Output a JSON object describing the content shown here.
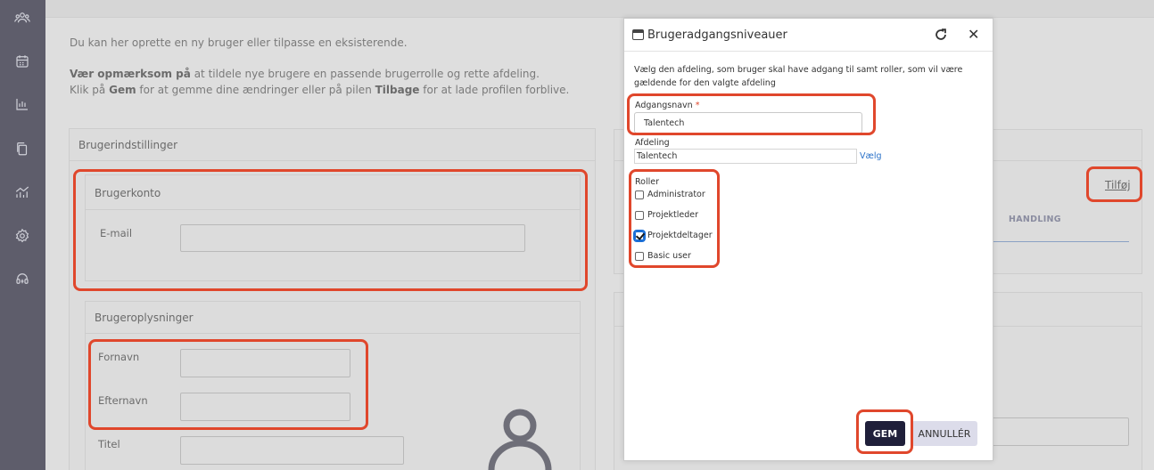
{
  "sidebar": {
    "items": [
      {
        "icon": "users-icon"
      },
      {
        "icon": "calendar-icon"
      },
      {
        "icon": "bar-chart-icon"
      },
      {
        "icon": "documents-icon"
      },
      {
        "icon": "analytics-icon"
      },
      {
        "icon": "gear-icon"
      },
      {
        "icon": "headset-icon"
      }
    ]
  },
  "intro": {
    "line1": "Du kan her oprette en ny bruger eller tilpasse en eksisterende.",
    "line2_bold": "Vær opmærksom på",
    "line2_rest": " at tildele nye brugere en passende brugerrolle og rette afdeling.",
    "line3_pre": "Klik på ",
    "line3_gem": "Gem",
    "line3_mid": " for at gemme dine ændringer eller på pilen ",
    "line3_tilbage": "Tilbage",
    "line3_post": " for at lade profilen forblive."
  },
  "settings": {
    "title": "Brugerindstillinger",
    "account_title": "Brugerkonto",
    "email_label": "E-mail",
    "info_title": "Brugeroplysninger",
    "firstname_label": "Fornavn",
    "lastname_label": "Efternavn",
    "title_label": "Titel"
  },
  "right_panel": {
    "add_link": "Tilføj",
    "action_header": "HANDLING"
  },
  "modal": {
    "title": "Brugeradgangsniveauer",
    "description": "Vælg den afdeling, som bruger skal have adgang til samt roller, som vil være gældende for den valgte afdeling",
    "access_name_label": "Adgangsnavn",
    "required_mark": "*",
    "access_name_value": "Talentech",
    "department_label": "Afdeling",
    "department_value": "Talentech",
    "choose_link": "Vælg",
    "roles_label": "Roller",
    "roles": [
      {
        "label": "Administrator",
        "checked": false
      },
      {
        "label": "Projektleder",
        "checked": false
      },
      {
        "label": "Projektdeltager",
        "checked": true
      },
      {
        "label": "Basic user",
        "checked": false
      }
    ],
    "save_label": "GEM",
    "cancel_label": "ANNULLÉR"
  },
  "colors": {
    "highlight": "#e0472c",
    "save_button": "#1f1f3a",
    "sidebar": "#5e5d6b",
    "link": "#2b72c9"
  }
}
